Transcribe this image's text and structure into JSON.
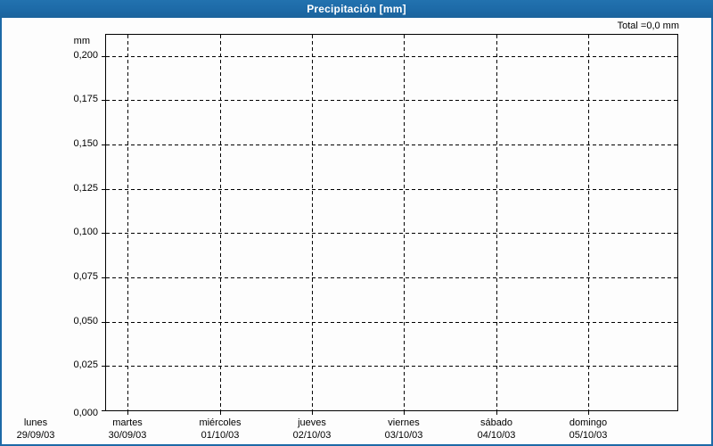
{
  "title_bar": {
    "title": "Precipitación [mm]"
  },
  "summary": {
    "total_label": "Total =0,0 mm"
  },
  "colors": {
    "accent_blue": "#1d6aa7",
    "grid": "#000000",
    "background": "#fdfdfd",
    "title_text": "#ffffff"
  },
  "chart_data": {
    "type": "bar",
    "title": "Precipitación [mm]",
    "ylabel": "mm",
    "xlabel": "",
    "ylim": [
      0,
      0.2125
    ],
    "yticks": [
      0.0,
      0.025,
      0.05,
      0.075,
      0.1,
      0.125,
      0.15,
      0.175,
      0.2
    ],
    "ytick_labels": [
      "0,000",
      "0,025",
      "0,050",
      "0,075",
      "0,100",
      "0,125",
      "0,150",
      "0,175",
      "0,200"
    ],
    "categories": [
      {
        "day": "lunes",
        "date": "29/09/03"
      },
      {
        "day": "martes",
        "date": "30/09/03"
      },
      {
        "day": "miércoles",
        "date": "01/10/03"
      },
      {
        "day": "jueves",
        "date": "02/10/03"
      },
      {
        "day": "viernes",
        "date": "03/10/03"
      },
      {
        "day": "sábado",
        "date": "04/10/03"
      },
      {
        "day": "domingo",
        "date": "05/10/03"
      }
    ],
    "series": [
      {
        "name": "Precipitación",
        "values": [
          0,
          0,
          0,
          0,
          0,
          0,
          0
        ]
      }
    ],
    "total": "0,0 mm",
    "grid": "dashed",
    "legend": "none"
  }
}
